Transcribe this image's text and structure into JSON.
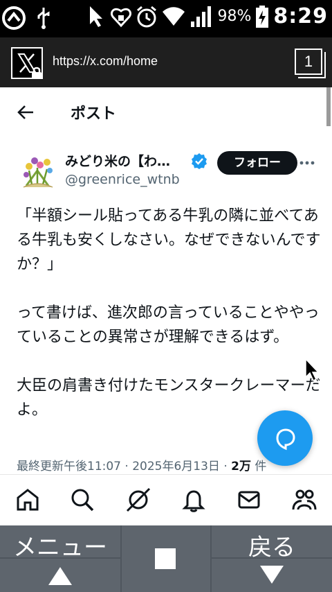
{
  "status_bar": {
    "battery_percent": "98%",
    "time": "8:29"
  },
  "browser": {
    "url": "https://x.com/home",
    "tab_count": "1"
  },
  "header": {
    "title": "ポスト"
  },
  "post": {
    "author_name": "みどり米の【わ…",
    "author_handle": "@greenrice_wtnb",
    "follow_label": "フォロー",
    "paragraphs": [
      "「半額シール貼ってある牛乳の隣に並べてある牛乳も安くしなさい。なぜできないんですか？」",
      "って書けば、進次郎の言っていることややっていることの異常さが理解できるはず。",
      "大臣の肩書き付けたモンスタークレーマーだよ。"
    ],
    "timestamp": "最終更新午後11:07",
    "date": "2025年6月13日",
    "views_count": "2万",
    "views_label": "件"
  },
  "bottom_nav": {
    "items": [
      "home-icon",
      "search-icon",
      "grok-icon",
      "notifications-icon",
      "messages-icon",
      "communities-icon"
    ]
  },
  "soft_keys": {
    "menu": "メニュー",
    "back": "戻る"
  },
  "colors": {
    "accent": "#1d9bf0",
    "text": "#0f1419",
    "secondary_text": "#536471"
  }
}
